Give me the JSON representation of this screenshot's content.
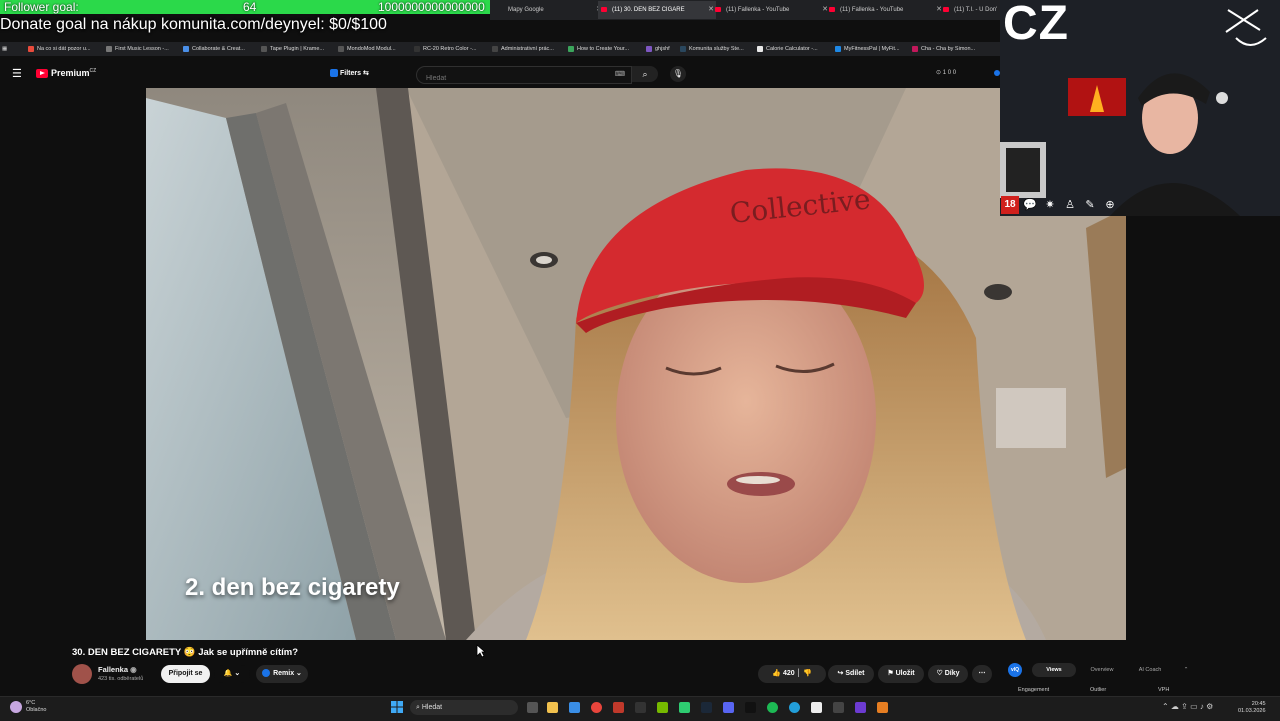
{
  "overlay": {
    "follower_goal_label": "Follower goal:",
    "follower_goal_current": "64",
    "follower_goal_target": "1000000000000000",
    "donate_text": "Donate goal na nákup komunita.com/deynyel: $0/$100",
    "cz_label": "CZ"
  },
  "browser": {
    "tabs": [
      {
        "label": "Mapy Google",
        "active": false
      },
      {
        "label": "(11) 30. DEN BEZ CIGARE",
        "active": true
      },
      {
        "label": "(11) Fallenka - YouTube",
        "active": false
      },
      {
        "label": "(11) Fallenka - YouTube",
        "active": false
      },
      {
        "label": "(11) T.I. - U Don'",
        "active": false
      }
    ],
    "bookmarks": [
      "Na co si dát pozor u...",
      "First Music Lesson -...",
      "Collaborate & Creat...",
      "Tape Plugin | Krame...",
      "MondoMod Modul...",
      "RC-20 Retro Color -...",
      "Administrativní prác...",
      "How to Create Your...",
      "ghjshf",
      "Komunita služby Ste...",
      "Calorie Calculator -...",
      "MyFitnessPal | MyFit...",
      "Cha - Cha by Simon..."
    ]
  },
  "youtube": {
    "logo": "Premium",
    "logo_region": "CZ",
    "filters_label": "Filters",
    "search_placeholder": "Hledat",
    "counts": "1  0  0",
    "subtitle": "2. den bez cigarety",
    "video_title": "30. DEN BEZ CIGARETY 😳 Jak se upřímně cítím?",
    "channel_name": "Fallenka",
    "subscriber_count": "423 tis. odběratelů",
    "subscribe_label": "Připojit se",
    "bell_label": "🔔 ⌄",
    "remix_label": "Remix",
    "like_count": "420",
    "share_label": "Sdílet",
    "save_label": "Uložit",
    "thanks_label": "Díky",
    "more_label": "⋯"
  },
  "vidiq": {
    "logo": "vIQ",
    "tabs": [
      "Views",
      "Overview",
      "AI Coach"
    ],
    "headers": [
      "Engagement",
      "Outlier",
      "VPH"
    ]
  },
  "taskbar": {
    "weather_temp": "6°C",
    "weather_desc": "Oblačno",
    "search_label": "Hledat",
    "time": "20:45",
    "date": "01.03.2026"
  },
  "colors": {
    "goal_bar": "#2bd94a",
    "youtube_red": "#ff0033",
    "vidiq_blue": "#1a73e8"
  }
}
